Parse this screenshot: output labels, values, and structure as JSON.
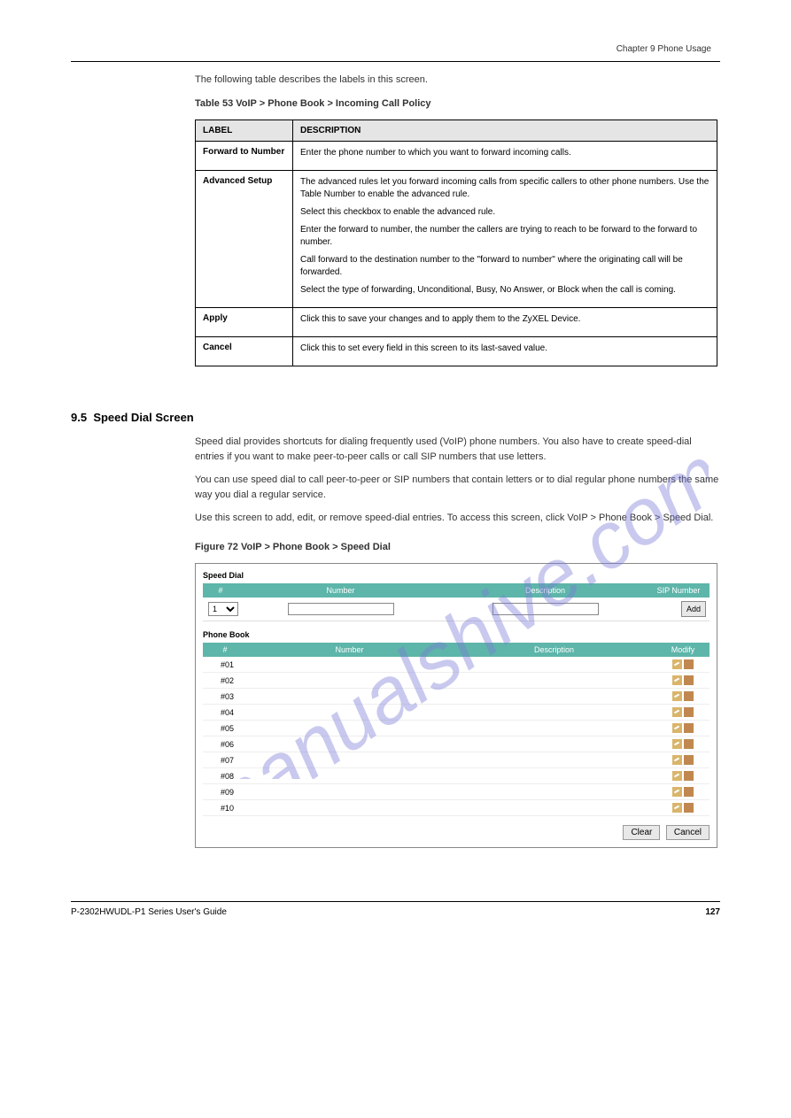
{
  "doc": {
    "product": "P-2302HWUDL-P1",
    "guide_type": "Series User's Guide",
    "chapter_label": "Chapter 9 Phone Usage",
    "page_label": "Chapter 9 Phone Usage",
    "page_number": "127"
  },
  "params_heading": "The following table describes the labels in this screen.",
  "table_caption": "Table 53   VoIP > Phone Book > Incoming Call Policy",
  "table": {
    "headers": [
      "LABEL",
      "DESCRIPTION"
    ],
    "rows": [
      {
        "label": "Forward to Number",
        "desc": [
          "Enter the phone number to which you want to forward incoming calls."
        ]
      },
      {
        "label": "Advanced Setup",
        "desc": [
          "The advanced rules let you forward incoming calls from specific callers to other phone numbers. Use the Table Number to enable the advanced rule.",
          "Select this checkbox to enable the advanced rule.",
          "Enter the forward to number, the number the callers are trying to reach to be forward to the forward to number.",
          "Call forward to the destination number to the \"forward to number\" where the originating call will be forwarded.",
          "Select the type of forwarding, Unconditional, Busy, No Answer, or Block when the call is coming."
        ]
      },
      {
        "label": "Apply",
        "desc": [
          "Click this to save your changes and to apply them to the ZyXEL Device."
        ]
      },
      {
        "label": "Cancel",
        "desc": [
          "Click this to set every field in this screen to its last-saved value."
        ]
      }
    ]
  },
  "section": {
    "number": "9.5",
    "title": "Speed Dial Screen",
    "p1": "Speed dial provides shortcuts for dialing frequently used (VoIP) phone numbers. You also have to create speed-dial entries if you want to make peer-to-peer calls or call SIP numbers that use letters.",
    "p2": "You can use speed dial to call peer-to-peer or SIP numbers that contain letters or to dial regular phone numbers the same way you dial a regular service.",
    "p3": "Use this screen to add, edit, or remove speed-dial entries. To access this screen, click VoIP > Phone Book > Speed Dial."
  },
  "screenshot": {
    "speed_dial_title": "Speed Dial",
    "sd_headers": {
      "h1": "#",
      "h2": "Number",
      "h3": "Description",
      "h4": "SIP Number"
    },
    "sd_select_value": "1",
    "sd_add_label": "Add",
    "phone_book_title": "Phone Book",
    "pb_headers": {
      "h1": "#",
      "h2": "Number",
      "h3": "Description",
      "h4": "Modify"
    },
    "rows": [
      {
        "num": "#01"
      },
      {
        "num": "#02"
      },
      {
        "num": "#03"
      },
      {
        "num": "#04"
      },
      {
        "num": "#05"
      },
      {
        "num": "#06"
      },
      {
        "num": "#07"
      },
      {
        "num": "#08"
      },
      {
        "num": "#09"
      },
      {
        "num": "#10"
      }
    ],
    "clear": "Clear",
    "cancel": "Cancel"
  },
  "figure_caption": "Figure 72   VoIP > Phone Book > Speed Dial"
}
